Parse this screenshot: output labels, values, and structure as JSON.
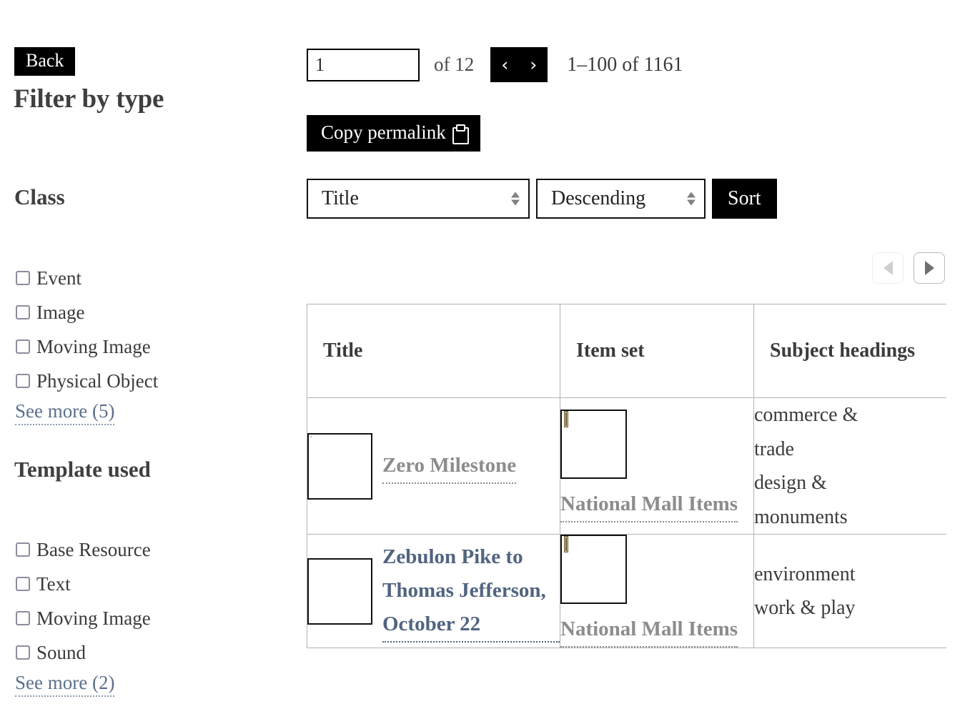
{
  "sidebar": {
    "back_label": "Back",
    "page_title": "Filter by type",
    "facets": [
      {
        "heading": "Class",
        "options": [
          "Event",
          "Image",
          "Moving Image",
          "Physical Object"
        ],
        "see_more": "See more (5)"
      },
      {
        "heading": "Template used",
        "options": [
          "Base Resource",
          "Text",
          "Moving Image",
          "Sound"
        ],
        "see_more": "See more (2)"
      }
    ]
  },
  "toolbar": {
    "page_value": "1",
    "page_placeholder": "",
    "of_total": "of 12",
    "prev_icon": "‹",
    "next_icon": "›",
    "range_label": "1–100 of 1161",
    "permalink_label": "Copy permalink",
    "permalink_icon": "clipboard-icon",
    "sort_by_value": "Title",
    "sort_by_options": [
      "Title"
    ],
    "sort_dir_value": "Descending",
    "sort_dir_options": [
      "Descending"
    ],
    "sort_button_label": "Sort"
  },
  "table_scroll": {
    "left_label": "◀",
    "right_label": "▶",
    "left_enabled": false,
    "right_enabled": true
  },
  "table": {
    "columns": [
      "Title",
      "Item set",
      "Subject headings"
    ],
    "rows": [
      {
        "title": "Zero Milestone",
        "title_state": "visited",
        "title_thumb": "monument-photo-thumbnail",
        "item_set": "National Mall Items",
        "item_set_state": "visited",
        "item_set_thumb": "book-cover-thumbnail",
        "subjects": [
          "commerce &",
          "trade",
          "design &",
          "monuments"
        ]
      },
      {
        "title": "Zebulon Pike to Thomas Jefferson, October 22",
        "title_state": "unvisited",
        "title_thumb": "manuscript-letter-thumbnail",
        "item_set": "National Mall Items",
        "item_set_state": "visited",
        "item_set_thumb": "book-cover-thumbnail",
        "subjects": [
          "environment",
          "work & play"
        ]
      }
    ]
  },
  "colors": {
    "accent_link": "#516480",
    "visited_link": "#8c8c8c",
    "button_bg": "#000000",
    "text": "#3b3b3b",
    "border": "#b3b3b3"
  }
}
